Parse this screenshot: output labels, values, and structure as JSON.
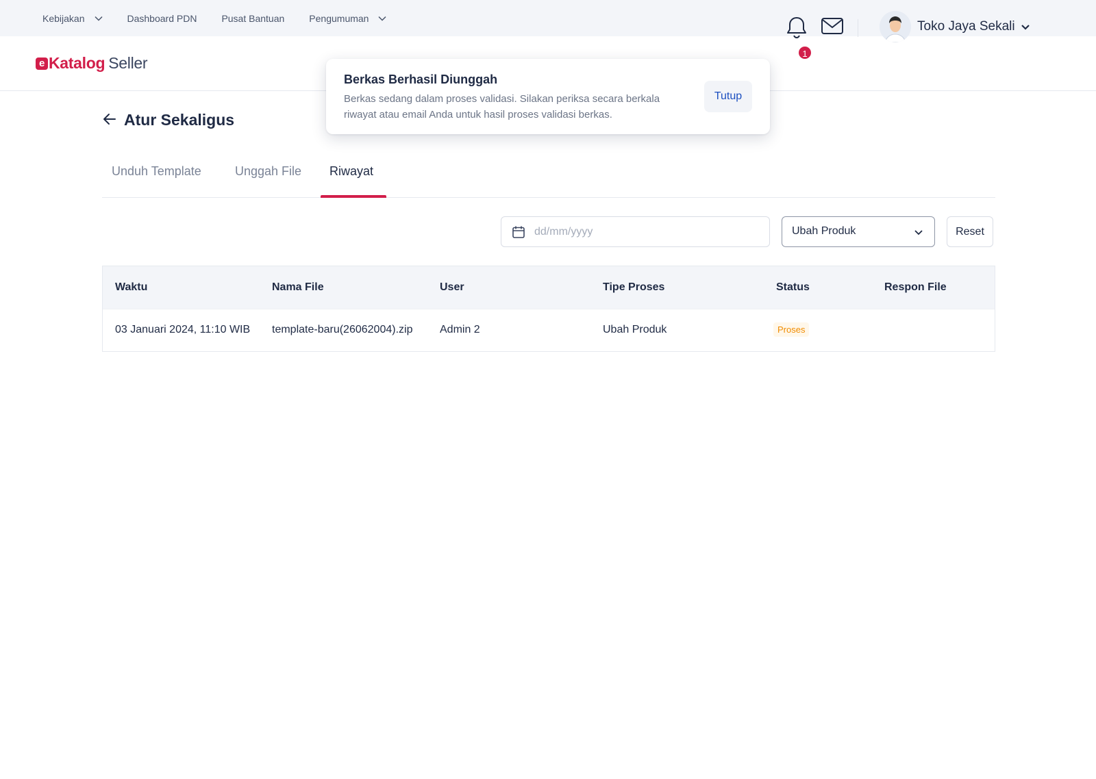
{
  "top_nav": {
    "items": [
      {
        "label": "Kebijakan",
        "has_dropdown": true
      },
      {
        "label": "Dashboard PDN",
        "has_dropdown": false
      },
      {
        "label": "Pusat Bantuan",
        "has_dropdown": false
      },
      {
        "label": "Pengumuman",
        "has_dropdown": true
      }
    ]
  },
  "header": {
    "logo_brand": "Katalog",
    "logo_suffix": "Seller",
    "notification_count": "1",
    "account_name": "Toko Jaya Sekali"
  },
  "toast": {
    "title": "Berkas Berhasil Diunggah",
    "message": "Berkas sedang dalam proses validasi. Silakan periksa secara berkala riwayat atau email Anda untuk hasil proses validasi berkas.",
    "close_label": "Tutup"
  },
  "page": {
    "title": "Atur Sekaligus"
  },
  "tabs": [
    {
      "label": "Unduh Template",
      "active": false
    },
    {
      "label": "Unggah File",
      "active": false
    },
    {
      "label": "Riwayat",
      "active": true
    }
  ],
  "filters": {
    "date_placeholder": "dd/mm/yyyy",
    "process_type_selected": "Ubah Produk",
    "reset_label": "Reset"
  },
  "table": {
    "columns": [
      "Waktu",
      "Nama File",
      "User",
      "Tipe Proses",
      "Status",
      "Respon File"
    ],
    "rows": [
      {
        "waktu": "03 Januari 2024, 11:10 WIB",
        "nama_file": "template-baru(26062004).zip",
        "user": "Admin 2",
        "tipe_proses": "Ubah Produk",
        "status": "Proses",
        "respon_file": ""
      }
    ]
  },
  "colors": {
    "brand": "#d21e4a",
    "link": "#1c4fc0",
    "status_process": "#f08c00"
  }
}
